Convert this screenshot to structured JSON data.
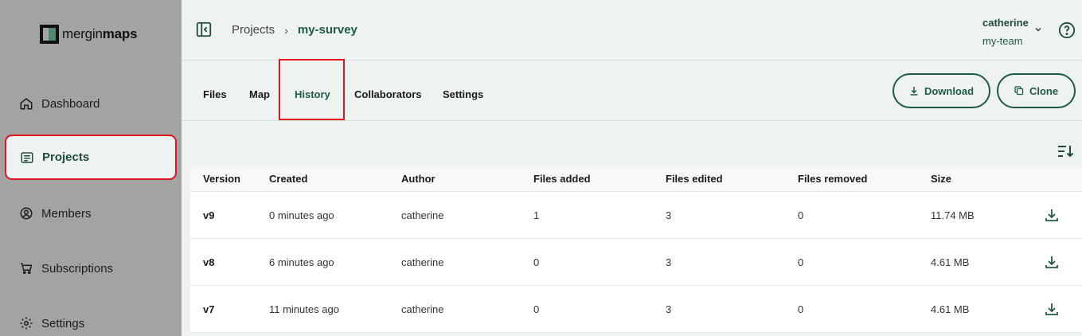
{
  "brand": {
    "logo_text_light": "mergin",
    "logo_text_bold": "maps"
  },
  "sidebar": {
    "items": [
      {
        "label": "Dashboard",
        "icon": "home-icon"
      },
      {
        "label": "Projects",
        "icon": "list-icon",
        "active": true
      },
      {
        "label": "Members",
        "icon": "user-circle-icon"
      },
      {
        "label": "Subscriptions",
        "icon": "cart-icon"
      },
      {
        "label": "Settings",
        "icon": "gear-icon"
      }
    ]
  },
  "header": {
    "breadcrumb": [
      "Projects",
      "my-survey"
    ],
    "separator": "›",
    "user": {
      "name": "catherine",
      "team": "my-team"
    }
  },
  "tabs": {
    "items": [
      "Files",
      "Map",
      "History",
      "Collaborators",
      "Settings"
    ],
    "active": "History"
  },
  "actions": {
    "download_label": "Download",
    "clone_label": "Clone"
  },
  "history": {
    "columns": [
      "Version",
      "Created",
      "Author",
      "Files added",
      "Files edited",
      "Files removed",
      "Size"
    ],
    "rows": [
      {
        "version": "v9",
        "created": "0 minutes ago",
        "author": "catherine",
        "added": "1",
        "edited": "3",
        "removed": "0",
        "size": "11.74 MB"
      },
      {
        "version": "v8",
        "created": "6 minutes ago",
        "author": "catherine",
        "added": "0",
        "edited": "3",
        "removed": "0",
        "size": "4.61 MB"
      },
      {
        "version": "v7",
        "created": "11 minutes ago",
        "author": "catherine",
        "added": "0",
        "edited": "3",
        "removed": "0",
        "size": "4.61 MB"
      }
    ]
  },
  "colors": {
    "accent": "#1f5a47",
    "highlight": "#e0141e",
    "sidebar_bg": "#a3a3a3",
    "page_bg": "#eef3f1"
  }
}
